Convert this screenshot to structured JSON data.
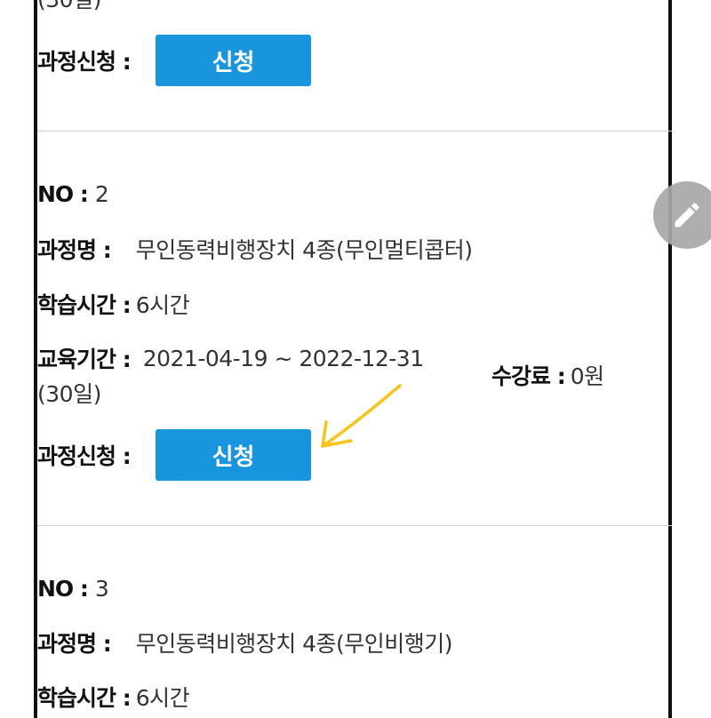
{
  "top_partial": {
    "period_suffix": "(30일)",
    "apply_label": "과정신청 :",
    "apply_button": "신청"
  },
  "course2": {
    "no_label": "NO :",
    "no": "2",
    "name_label": "과정명 :",
    "name": "무인동력비행장치 4종(무인멀티콥터)",
    "hours_label": "학습시간 :",
    "hours": "6시간",
    "period_label": "교육기간 :",
    "period": "2021-04-19 ~ 2022-12-31",
    "period_days": "(30일)",
    "fee_label": "수강료 :",
    "fee": "0원",
    "apply_label": "과정신청 :",
    "apply_button": "신청"
  },
  "course3": {
    "no_label": "NO :",
    "no": "3",
    "name_label": "과정명 :",
    "name": "무인동력비행장치 4종(무인비행기)",
    "hours_label": "학습시간 :",
    "hours": "6시간"
  },
  "fab_icon": "pencil-icon",
  "annotation_arrow_color": "#f5c51b",
  "button_color": "#1995dd"
}
